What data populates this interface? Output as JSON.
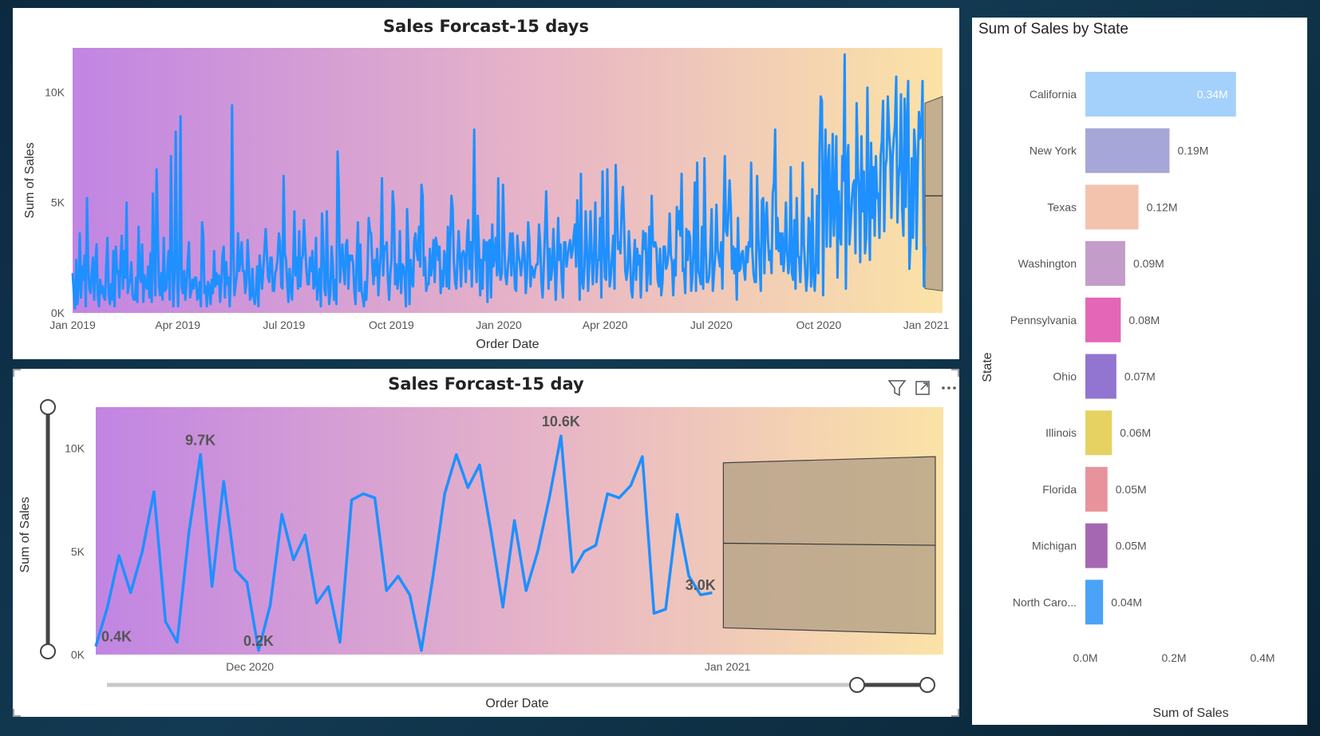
{
  "colors": {
    "line": "#1E90FF",
    "gradient_start": "#C185E3",
    "gradient_mid": "#E8B6C6",
    "gradient_end": "#FBE3A6",
    "forecast_band": "#B9A48A"
  },
  "top_panel": {
    "title": "Sales Forcast-15 days",
    "ylabel": "Sum of Sales",
    "xlabel": "Order Date",
    "y_ticks": [
      "0K",
      "5K",
      "10K"
    ],
    "x_ticks": [
      "Jan 2019",
      "Apr 2019",
      "Jul 2019",
      "Oct 2019",
      "Jan 2020",
      "Apr 2020",
      "Jul 2020",
      "Oct 2020",
      "Jan 2021"
    ]
  },
  "bottom_panel": {
    "title": "Sales Forcast-15 day",
    "ylabel": "Sum of Sales",
    "xlabel": "Order Date",
    "y_ticks": [
      "0K",
      "5K",
      "10K"
    ],
    "x_ticks": [
      "Dec 2020",
      "Jan 2021"
    ],
    "icons": [
      "filter-icon",
      "focus-mode-icon",
      "more-options-icon"
    ]
  },
  "right_panel": {
    "title": "Sum of Sales by State",
    "ylabel": "State",
    "xlabel": "Sum of Sales",
    "x_ticks": [
      "0.0M",
      "0.2M",
      "0.4M"
    ]
  },
  "chart_data": [
    {
      "type": "line",
      "title": "Sales Forcast-15 days",
      "xlabel": "Order Date",
      "ylabel": "Sum of Sales",
      "x_range": [
        "2019-01-01",
        "2021-01-15"
      ],
      "ylim": [
        0,
        12000
      ],
      "forecast": {
        "x_start": "2020-12-31",
        "x_end": "2021-01-15",
        "lower": [
          1100,
          1000
        ],
        "upper": [
          9500,
          9800
        ],
        "point": [
          5300,
          5300
        ]
      },
      "series": [
        {
          "values": [
            1800,
            900,
            200,
            2400,
            400,
            1200,
            3600,
            700,
            2100,
            1500,
            2600,
            300,
            5200,
            2100,
            1100,
            900,
            1800,
            2500,
            600,
            2200,
            3100,
            800,
            300,
            1500,
            900,
            1200,
            700,
            600,
            2100,
            3400,
            900,
            400,
            1300,
            600,
            2800,
            300,
            3000,
            1800,
            1900,
            700,
            2400,
            3500,
            1100,
            2800,
            1600,
            5000,
            900,
            1300,
            1500,
            2300,
            800,
            600,
            600,
            1600,
            500,
            3900,
            1800,
            1400,
            3100,
            500,
            1700,
            1200,
            1100,
            2100,
            700,
            2700,
            500,
            5400,
            2300,
            800,
            6500,
            3700,
            1200,
            800,
            1800,
            600,
            3400,
            1000,
            1100,
            1900,
            2800,
            600,
            7100,
            2600,
            300,
            1800,
            8200,
            2100,
            300,
            2400,
            8900,
            1200,
            900,
            1900,
            600,
            1300,
            2300,
            3200,
            700,
            1000,
            1500,
            1100,
            1600,
            1600,
            600,
            700,
            1400,
            300,
            4100,
            3500,
            900,
            1200,
            300,
            1400,
            1200,
            400,
            1500,
            900,
            2800,
            1200,
            1800,
            1300,
            1700,
            500,
            1300,
            2600,
            3000,
            700,
            2300,
            1300,
            1600,
            300,
            1900,
            9400,
            3100,
            800,
            1300,
            1700,
            3600,
            1900,
            2400,
            3200,
            1900,
            1900,
            900,
            1400,
            3300,
            2200,
            600,
            800,
            2000,
            700,
            400,
            1000,
            2100,
            300,
            2600,
            1900,
            1100,
            1900,
            2800,
            3800,
            2700,
            1600,
            1400,
            2500,
            2500,
            1000,
            1000,
            1800,
            2000,
            2500,
            3600,
            3200,
            1200,
            1100,
            6200,
            2700,
            2400,
            1400,
            500,
            2000,
            1100,
            600,
            2200,
            4600,
            1700,
            2500,
            1100,
            3700,
            1200,
            2400,
            2600,
            4200,
            3000,
            2000,
            1300,
            1300,
            2500,
            1900,
            2800,
            1100,
            1300,
            3400,
            600,
            1300,
            2000,
            300,
            4500,
            3000,
            1100,
            800,
            4600,
            1700,
            400,
            1000,
            3000,
            2200,
            600,
            1500,
            400,
            7300,
            5600,
            1400,
            2300,
            3100,
            2000,
            1300,
            3100,
            3300,
            1100,
            2600,
            2400,
            2600,
            2200,
            1000,
            400,
            2500,
            4100,
            1000,
            3100,
            1000,
            700,
            300,
            1400,
            600,
            1900,
            4300,
            3700,
            3600,
            2200,
            1300,
            2400,
            1700,
            2900,
            800,
            1900,
            2700,
            6100,
            1700,
            3000,
            2900,
            3200,
            1500,
            600,
            1800,
            2400,
            5500,
            4700,
            1300,
            2200,
            1100,
            1700,
            3700,
            900,
            2200,
            2100,
            1600,
            300,
            4700,
            3000,
            400,
            2400,
            1400,
            1200,
            3300,
            3600,
            2800,
            2400,
            3900,
            2100,
            5800,
            5300,
            1700,
            2500,
            1000,
            1300,
            1300,
            2900,
            1700,
            2200,
            3300,
            1400,
            3400,
            3000,
            2400,
            3000,
            900,
            1900,
            1200,
            2800,
            2300,
            1200,
            3900,
            1100,
            3400,
            5300,
            4700,
            2300,
            1400,
            1100,
            2400,
            3700,
            2500,
            1200,
            2700,
            2800,
            2600,
            1400,
            3400,
            4200,
            2000,
            3200,
            1200,
            3700,
            8300,
            2900,
            1400,
            4400,
            2800,
            800,
            2400,
            1100,
            3300,
            2400,
            3200,
            500,
            3200,
            3300,
            700,
            4000,
            2100,
            2600,
            3400,
            1700,
            6100,
            2000,
            1500,
            1800,
            5800,
            3400,
            1700,
            1300,
            2000,
            2600,
            3600,
            1700,
            3600,
            2600,
            1100,
            1000,
            3500,
            2600,
            2300,
            1700,
            2300,
            3200,
            2600,
            900,
            1700,
            4100,
            3300,
            1200,
            2100,
            1900,
            1600,
            2000,
            2200,
            2200,
            4000,
            3100,
            1400,
            700,
            2100,
            3700,
            5500,
            3100,
            1100,
            2900,
            1500,
            2000,
            3800,
            2300,
            600,
            2300,
            4300,
            2400,
            3100,
            1500,
            700,
            3200,
            3200,
            2100,
            2600,
            3000,
            3300,
            2500,
            2800,
            3500,
            4000,
            2100,
            5100,
            3200,
            600,
            6300,
            1400,
            1100,
            2100,
            4600,
            3000,
            1000,
            2300,
            4600,
            2600,
            1300,
            2800,
            5000,
            1400,
            2400,
            2400,
            4300,
            700,
            6400,
            3200,
            1600,
            1500,
            6500,
            3000,
            1200,
            1700,
            2600,
            3500,
            1100,
            6700,
            4600,
            2900,
            3200,
            2700,
            4800,
            5700,
            4000,
            1900,
            1500,
            2000,
            3700,
            2600,
            1000,
            700,
            2300,
            3300,
            1500,
            2900,
            2200,
            2600,
            700,
            2300,
            3700,
            2900,
            3600,
            1000,
            2100,
            3900,
            1300,
            5300,
            3200,
            3000,
            3200,
            2900,
            1500,
            1200,
            2900,
            800,
            1400,
            3000,
            3000,
            2000,
            2200,
            2800,
            4500,
            2600,
            2300,
            800,
            2400,
            1700,
            4800,
            3800,
            4600,
            3500,
            6300,
            1900,
            2000,
            900,
            3800,
            2400,
            3700,
            3400,
            1000,
            1600,
            3000,
            5900,
            1000,
            6800,
            1900,
            1700,
            1300,
            3900,
            1100,
            7000,
            3000,
            1400,
            1400,
            1700,
            2900,
            4700,
            1000,
            1800,
            2600,
            4900,
            2900,
            2500,
            2100,
            3200,
            1100,
            4400,
            7100,
            3700,
            3500,
            4600,
            6000,
            4800,
            2000,
            3000,
            1800,
            2900,
            600,
            4300,
            1900,
            2000,
            2700,
            2800,
            2000,
            1500,
            3000,
            2300,
            3200,
            3000,
            6800,
            2800,
            1800,
            1400,
            1400,
            6200,
            3400,
            2300,
            1000,
            5100,
            5200,
            1800,
            4200,
            5000,
            3300,
            2400,
            2800,
            1800,
            5400,
            5900,
            8300,
            2900,
            4300,
            2800,
            3600,
            2200,
            3600,
            1900,
            2800,
            5000,
            2800,
            1800,
            2400,
            6600,
            1800,
            1500,
            4200,
            1100,
            5200,
            2600,
            2500,
            1400,
            3000,
            6800,
            3100,
            2100,
            1000,
            1700,
            4300,
            3900,
            1200,
            5600,
            1700,
            1000,
            2300,
            5300,
            1800,
            7300,
            9800,
            9600,
            800,
            5700,
            8300,
            3000,
            6700,
            7600,
            3000,
            4700,
            8100,
            3500,
            5300,
            8000,
            1600,
            5500,
            3600,
            3100,
            7100,
            6000,
            11700,
            1100,
            6600,
            7600,
            3100,
            4000,
            5100,
            5800,
            6000,
            2700,
            9500,
            6600,
            5400,
            2300,
            8000,
            4600,
            6400,
            2700,
            3400,
            10200,
            5100,
            2400,
            7700,
            4300,
            6600,
            3500,
            7100,
            5200,
            5400,
            3400,
            7100,
            7800,
            9600,
            3700,
            6600,
            7000,
            9800,
            8200,
            7300,
            4300,
            7100,
            7900,
            8500,
            10700,
            4100,
            6100,
            6700,
            9900,
            4700,
            3500,
            9700,
            4800,
            8700,
            10500,
            2000,
            3400,
            7000,
            3400,
            8300,
            7300,
            2900,
            6600,
            9100,
            7900,
            8200,
            10500,
            1200,
            3000
          ]
        }
      ]
    },
    {
      "type": "line",
      "title": "Sales Forcast-15 day",
      "xlabel": "Order Date",
      "ylabel": "Sum of Sales",
      "x_range": [
        "2020-11-21",
        "2021-01-15"
      ],
      "ylim": [
        0,
        12000
      ],
      "data_labels": [
        "0.4K",
        "9.7K",
        "0.2K",
        "10.6K",
        "3.0K"
      ],
      "forecast": {
        "x_start": "2020-12-31",
        "x_end": "2021-01-15",
        "lower": [
          1300,
          1000
        ],
        "upper": [
          9300,
          9600
        ],
        "point": [
          5400,
          5300
        ]
      },
      "series": [
        {
          "values": [
            400,
            2300,
            4800,
            3000,
            5000,
            7900,
            1600,
            600,
            5900,
            9700,
            3300,
            8400,
            4100,
            3500,
            200,
            2400,
            6800,
            4600,
            5800,
            2500,
            3300,
            600,
            7500,
            7800,
            7600,
            3100,
            3800,
            2900,
            200,
            3800,
            7800,
            9700,
            8100,
            9200,
            5900,
            2300,
            6500,
            3100,
            5000,
            7600,
            10600,
            4000,
            5000,
            5300,
            7800,
            7600,
            8200,
            9600,
            2000,
            2200,
            6800,
            3800,
            2900,
            3000
          ]
        }
      ]
    },
    {
      "type": "bar",
      "orientation": "horizontal",
      "title": "Sum of Sales by State",
      "xlabel": "Sum of Sales",
      "ylabel": "State",
      "xlim": [
        0,
        0.4
      ],
      "categories": [
        "California",
        "New York",
        "Texas",
        "Washington",
        "Pennsylvania",
        "Ohio",
        "Illinois",
        "Florida",
        "Michigan",
        "North Caro..."
      ],
      "values": [
        0.34,
        0.19,
        0.12,
        0.09,
        0.08,
        0.07,
        0.06,
        0.05,
        0.05,
        0.04
      ],
      "value_labels": [
        "0.34M",
        "0.19M",
        "0.12M",
        "0.09M",
        "0.08M",
        "0.07M",
        "0.06M",
        "0.05M",
        "0.05M",
        "0.04M"
      ],
      "bar_colors": [
        "#A3D1FB",
        "#A6A6D8",
        "#F3C3AE",
        "#C49CCA",
        "#E466B7",
        "#9175D0",
        "#E6D262",
        "#E8939B",
        "#A667B2",
        "#4AA3F7"
      ]
    }
  ]
}
